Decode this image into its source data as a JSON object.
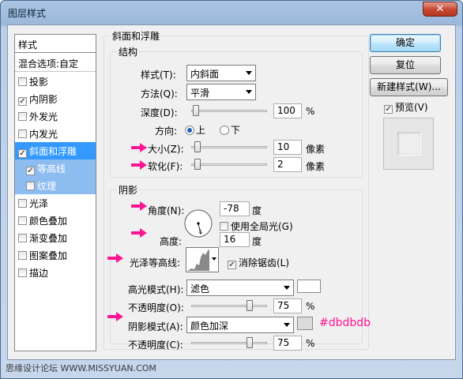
{
  "window": {
    "title": "图层样式",
    "close_glyph": "✕"
  },
  "stylelist": {
    "header": "样式",
    "blend": "混合选项:自定",
    "items": [
      {
        "label": "投影",
        "checked": false
      },
      {
        "label": "内阴影",
        "checked": true
      },
      {
        "label": "外发光",
        "checked": false
      },
      {
        "label": "内发光",
        "checked": false
      },
      {
        "label": "斜面和浮雕",
        "checked": true
      },
      {
        "label": "等高线",
        "checked": true
      },
      {
        "label": "纹理",
        "checked": false
      },
      {
        "label": "光泽",
        "checked": false
      },
      {
        "label": "颜色叠加",
        "checked": false
      },
      {
        "label": "渐变叠加",
        "checked": false
      },
      {
        "label": "图案叠加",
        "checked": false
      },
      {
        "label": "描边",
        "checked": false
      }
    ]
  },
  "bevel": {
    "group_title": "斜面和浮雕",
    "structure_title": "结构",
    "style_label": "样式(T):",
    "style_value": "内斜面",
    "technique_label": "方法(Q):",
    "technique_value": "平滑",
    "depth_label": "深度(D):",
    "depth_value": "100",
    "depth_level": 1.0,
    "depth_unit": "%",
    "direction_label": "方向:",
    "dir_up": "上",
    "dir_down": "下",
    "size_label": "大小(Z):",
    "size_value": "10",
    "size_unit": "像素",
    "soften_label": "软化(F):",
    "soften_value": "2",
    "soften_unit": "像素"
  },
  "shading": {
    "title": "阴影",
    "angle_label": "角度(N):",
    "angle_value": "-78",
    "angle_unit": "度",
    "global_light_label": "使用全局光(G)",
    "altitude_label": "高度:",
    "altitude_value": "16",
    "altitude_unit": "度",
    "gloss_contour_label": "光泽等高线:",
    "anti_alias_label": "消除锯齿(L)",
    "highlight_mode_label": "高光模式(H):",
    "highlight_mode_value": "滤色",
    "highlight_color": "#ffffff",
    "opacity_label": "不透明度(O):",
    "highlight_opacity": "75",
    "shadow_mode_label": "阴影模式(A):",
    "shadow_mode_value": "颜色加深",
    "shadow_color": "#dbdbdb",
    "shadow_color_note": "#dbdbdb",
    "opacity2_label": "不透明度(C):",
    "shadow_opacity": "75",
    "pct": "%"
  },
  "buttons": {
    "ok": "确定",
    "reset": "复位",
    "new_style": "新建样式(W)...",
    "preview": "预览(V)"
  },
  "watermark": "思缘设计论坛  WWW.MISSYUAN.COM",
  "colors": {
    "accent_pink": "#ff1493",
    "selection": "#3399ff"
  }
}
